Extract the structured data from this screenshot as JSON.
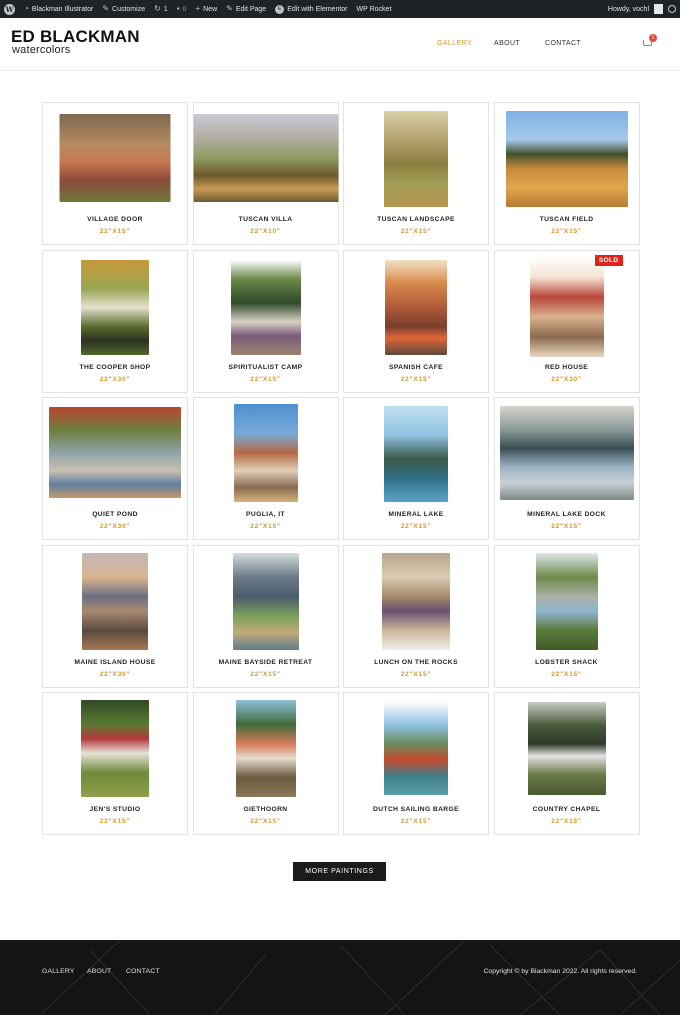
{
  "adminbar": {
    "site_name": "Blackman Illustrator",
    "customize": "Customize",
    "updates_count": "1",
    "comments_count": "0",
    "new": "New",
    "edit_page": "Edit Page",
    "elementor": "Edit with Elementor",
    "rocket": "WP Rocket",
    "howdy": "Howdy, vochl"
  },
  "header": {
    "logo_line1": "ED BLACKMAN",
    "logo_line2": "watercolors",
    "nav": [
      "GALLERY",
      "ABOUT",
      "CONTACT"
    ],
    "active_nav": "GALLERY",
    "cart_count": "1"
  },
  "paintings": [
    {
      "title": "VILLAGE DOOR",
      "size": "22\"X15\"",
      "sold": false
    },
    {
      "title": "TUSCAN VILLA",
      "size": "22\"X10\"",
      "sold": false
    },
    {
      "title": "TUSCAN LANDSCAPE",
      "size": "22\"X15\"",
      "sold": false
    },
    {
      "title": "TUSCAN FIELD",
      "size": "22\"X15\"",
      "sold": false
    },
    {
      "title": "THE COOPER SHOP",
      "size": "22\"X30\"",
      "sold": false
    },
    {
      "title": "SPIRITUALIST CAMP",
      "size": "22\"X15\"",
      "sold": false
    },
    {
      "title": "SPANISH CAFE",
      "size": "22\"X15\"",
      "sold": false
    },
    {
      "title": "RED HOUSE",
      "size": "22\"X30\"",
      "sold": true
    },
    {
      "title": "QUIET POND",
      "size": "22\"X30\"",
      "sold": false
    },
    {
      "title": "PUGLIA, IT",
      "size": "22\"X15\"",
      "sold": false
    },
    {
      "title": "MINERAL LAKE",
      "size": "22\"X15\"",
      "sold": false
    },
    {
      "title": "MINERAL LAKE DOCK",
      "size": "22\"X15\"",
      "sold": false
    },
    {
      "title": "MAINE ISLAND HOUSE",
      "size": "22\"X30\"",
      "sold": false
    },
    {
      "title": "MAINE BAYSIDE RETREAT",
      "size": "22\"X15\"",
      "sold": false
    },
    {
      "title": "LUNCH ON THE ROCKS",
      "size": "22\"X15\"",
      "sold": false
    },
    {
      "title": "LOBSTER SHACK",
      "size": "22\"X15\"",
      "sold": false
    },
    {
      "title": "JEN'S STUDIO",
      "size": "22\"X15\"",
      "sold": false
    },
    {
      "title": "GIETHOORN",
      "size": "22\"X15\"",
      "sold": false
    },
    {
      "title": "DUTCH SAILING BARGE",
      "size": "22\"X15\"",
      "sold": false
    },
    {
      "title": "COUNTRY CHAPEL",
      "size": "22\"X15\"",
      "sold": false
    }
  ],
  "sold_label": "SOLD",
  "more_button": "MORE PAINTINGS",
  "footer": {
    "nav": [
      "GALLERY",
      "ABOUT",
      "CONTACT"
    ],
    "copyright": "Copyright © by Blackman 2022. All rights reserved."
  }
}
